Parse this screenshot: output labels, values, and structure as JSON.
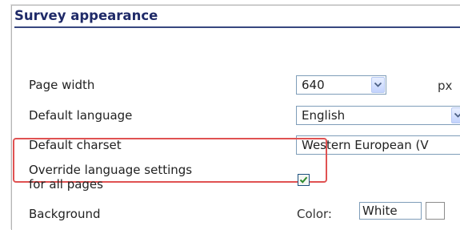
{
  "section": {
    "title": "Survey appearance"
  },
  "page_width": {
    "label": "Page width",
    "value": "640",
    "unit": "px"
  },
  "default_language": {
    "label": "Default language",
    "value": "English"
  },
  "default_charset": {
    "label": "Default charset",
    "value": "Western European (V"
  },
  "override": {
    "label_line1": "Override language settings",
    "label_line2": "for all pages",
    "checked": true
  },
  "background": {
    "label": "Background",
    "color_label": "Color:",
    "color_value": "White"
  },
  "colors": {
    "title": "#1f2a68",
    "highlight": "#e05252",
    "check": "#2e8b2e"
  }
}
